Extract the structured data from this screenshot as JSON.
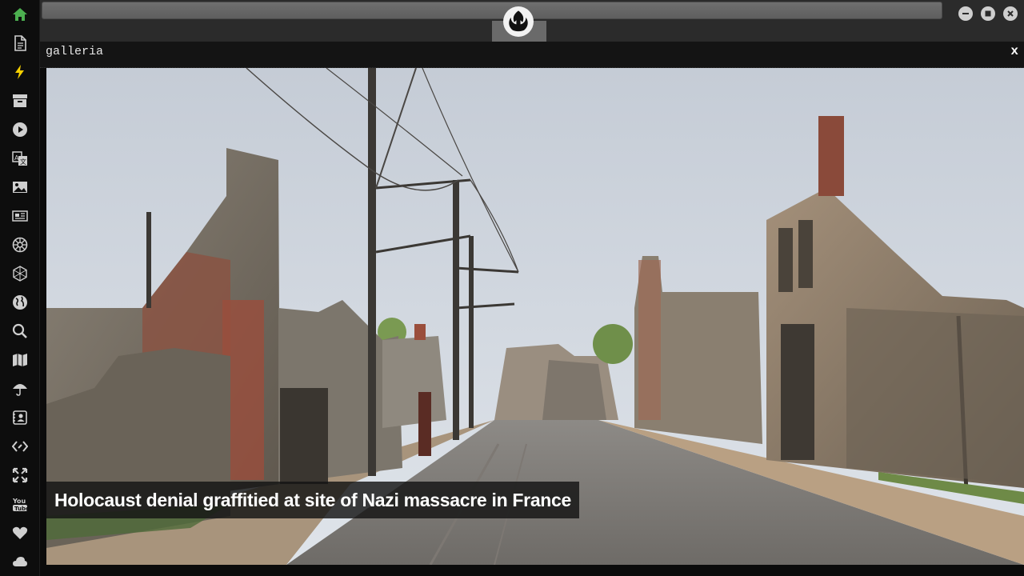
{
  "sidebar": {
    "items": [
      {
        "icon": "home-icon",
        "color": "#4caf50"
      },
      {
        "icon": "document-icon"
      },
      {
        "icon": "lightning-icon",
        "color": "#f5d000"
      },
      {
        "icon": "archive-icon"
      },
      {
        "icon": "play-icon"
      },
      {
        "icon": "translate-icon"
      },
      {
        "icon": "image-icon"
      },
      {
        "icon": "newspaper-icon"
      },
      {
        "icon": "empire-icon"
      },
      {
        "icon": "hexagon-icon"
      },
      {
        "icon": "globe-icon"
      },
      {
        "icon": "search-icon"
      },
      {
        "icon": "map-icon"
      },
      {
        "icon": "umbrella-icon"
      },
      {
        "icon": "contact-card-icon"
      },
      {
        "icon": "code-icon"
      },
      {
        "icon": "fullscreen-icon"
      },
      {
        "icon": "youtube-icon"
      },
      {
        "icon": "heart-icon"
      },
      {
        "icon": "cloud-icon"
      }
    ]
  },
  "topbar": {
    "url_value": "",
    "logo": "rebel-alliance-icon"
  },
  "panel": {
    "title": "galleria",
    "close_label": "x"
  },
  "gallery": {
    "caption": "Holocaust denial graffitied at site of Nazi massacre in France"
  },
  "colors": {
    "background": "#0b0b0b",
    "topbar": "#2b2b2b",
    "icon_default": "#cfcfcf",
    "home_accent": "#4caf50",
    "lightning_accent": "#f5d000"
  }
}
